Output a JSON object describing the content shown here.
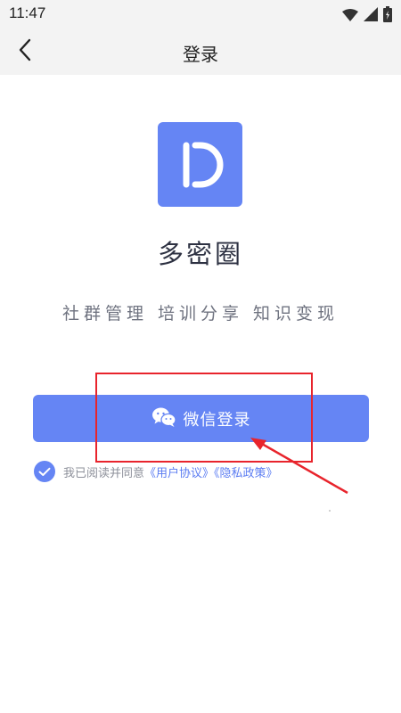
{
  "status_bar": {
    "time": "11:47",
    "icons": [
      "wifi-icon",
      "signal-icon",
      "battery-icon"
    ]
  },
  "nav": {
    "back_icon": "chevron-left-icon",
    "title": "登录"
  },
  "app": {
    "name": "多密圈",
    "slogan": "社群管理 培训分享 知识变现",
    "logo_letter": "D"
  },
  "login": {
    "wechat_label": "微信登录",
    "wechat_icon": "wechat-icon"
  },
  "agreement": {
    "checked": true,
    "text": "我已阅读并同意",
    "user_agreement": "《用户协议》",
    "privacy_policy": "《隐私政策》"
  },
  "colors": {
    "accent": "#6585f4",
    "link": "#5b7cf2",
    "annotation": "#e8242c",
    "bar_bg": "#f3f3f3"
  }
}
